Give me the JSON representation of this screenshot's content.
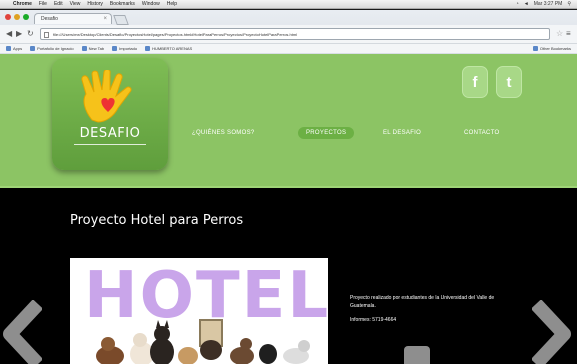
{
  "menubar": {
    "apple_icon": "apple-icon",
    "app_name": "Chrome",
    "items": [
      "File",
      "Edit",
      "View",
      "History",
      "Bookmarks",
      "Window",
      "Help"
    ],
    "status": "Mar 3:27 PM"
  },
  "browser": {
    "tab_title": "Desafio",
    "url": "file:///Users/me/Desktop/Clients/Desafio/ProyectosHotel/pages/Proyectos.html#HotelParaPerros/Proyectos/ProyectoHotelParaPerros.html",
    "bookmarks": [
      "Apps",
      "Portafolio de Ignacio",
      "New Tab",
      "Importado",
      "HUMBERTO ARENAS"
    ],
    "other_bookmarks": "Other Bookmarks"
  },
  "site": {
    "logo_text": "DESAFIO",
    "social": {
      "facebook": "f",
      "twitter": "t"
    },
    "nav": {
      "quienes": "¿QUIÉNES SOMOS?",
      "proyectos": "PROYECTOS",
      "desafio": "EL DESAFIO",
      "contacto": "CONTACTO"
    },
    "project_title": "Proyecto Hotel para Perros",
    "hero_word": "HOTEL",
    "description": [
      "Proyecto realizado por estudiantes de la Universidad del Valle de Guatemala.",
      "Informes: 5719-4664"
    ]
  },
  "colors": {
    "header_green": "#8cc464",
    "logo_green": "#6aac44",
    "active_pill": "#6cb044",
    "hotel_lilac": "#c9a5ea",
    "content_bg": "#000000"
  }
}
